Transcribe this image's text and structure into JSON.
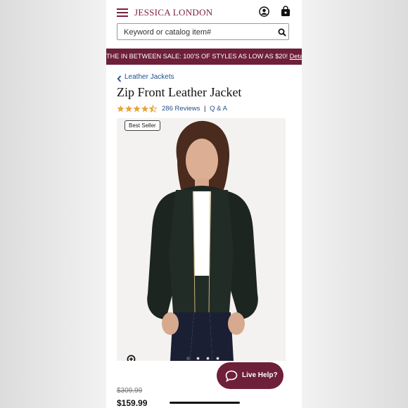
{
  "header": {
    "brand": "JESSICA LONDON"
  },
  "search": {
    "placeholder": "Keyword or catalog item#"
  },
  "banner": {
    "text": "THE IN BETWEEN SALE: 100'S OF STYLES AS LOW AS $20!",
    "link": "Details"
  },
  "breadcrumb": {
    "label": "Leather Jackets"
  },
  "product": {
    "title": "Zip Front Leather Jacket",
    "rating": 4.5,
    "max_rating": 5,
    "reviews_label": "286 Reviews",
    "qa_label": "Q & A",
    "badge": "Best Seller",
    "old_price": "$309.99",
    "price": "$159.99",
    "carousel": {
      "total": 4,
      "active": 1
    }
  },
  "help": {
    "label": "Live Help?"
  },
  "colors": {
    "brand": "#7a1f3d",
    "banner": "#6e1f3a",
    "link": "#1f4f8f",
    "star": "#e8a23a"
  }
}
